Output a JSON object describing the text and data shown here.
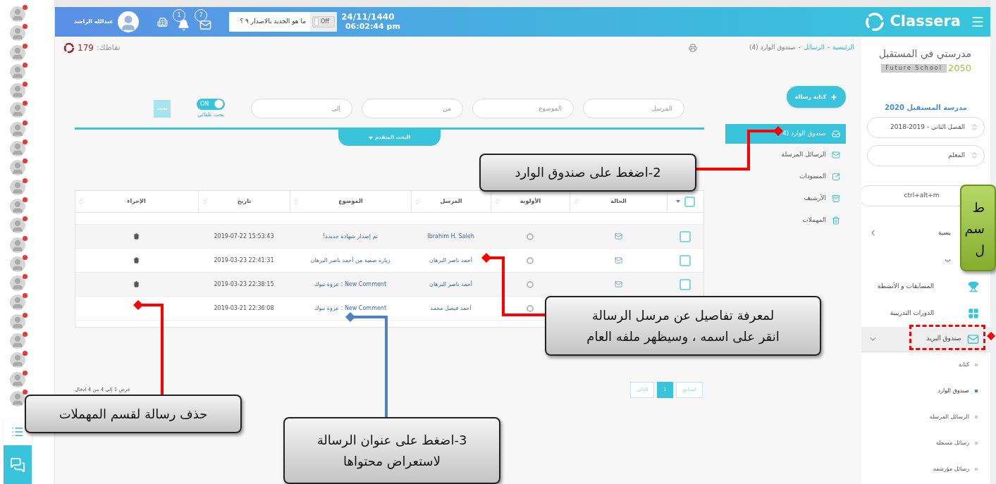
{
  "header": {
    "user_name": "عبدالله الراشد",
    "notifications": "1",
    "messages": "7",
    "whats_new": "ما هو الجديد بالاصدار ٩ ؟",
    "whats_new_toggle": {
      "label": "Off",
      "on": false
    },
    "date": "24/11/1440",
    "time": "06:02:44 pm",
    "brand": "Classera"
  },
  "contacts": [
    {
      "online": true
    },
    {
      "online": true
    },
    {
      "online": true
    },
    {
      "online": true
    },
    {
      "online": true
    },
    {
      "online": true
    },
    {
      "online": true
    },
    {
      "online": true
    },
    {
      "online": true
    },
    {
      "online": true
    },
    {
      "online": true
    },
    {
      "online": true
    },
    {
      "online": true
    },
    {
      "online": true
    },
    {
      "online": true
    },
    {
      "online": true
    },
    {
      "online": true
    },
    {
      "online": true
    },
    {
      "online": true
    },
    {
      "online": true
    },
    {
      "online": true
    }
  ],
  "points": {
    "label": "نقاطك:",
    "value": "179"
  },
  "breadcrumb": {
    "separator": "-",
    "items": [
      {
        "text": "الرئيسية",
        "link": true
      },
      {
        "text": "الرسائل",
        "link": true
      },
      {
        "text": "صندوق الوارد (4)",
        "link": false
      }
    ]
  },
  "search": {
    "fields": [
      {
        "placeholder": "المرسل"
      },
      {
        "placeholder": "الموضوع"
      },
      {
        "placeholder": "من"
      },
      {
        "placeholder": "إلى"
      }
    ],
    "instant": {
      "label": "ON",
      "caption": "بحث تلقائي",
      "on": true
    },
    "button": "بحث",
    "advanced": "البحث المتقدم"
  },
  "compose_button": "كتابة رسالة",
  "folders": [
    {
      "label": "صندوق الوارد (4",
      "selected": true
    },
    {
      "label": "الرسائل المرسلة",
      "selected": false
    },
    {
      "label": "المسودات",
      "selected": false
    },
    {
      "label": "الأرشيف",
      "selected": false
    },
    {
      "label": "المهملات",
      "selected": false
    }
  ],
  "table": {
    "columns": [
      "الحالة",
      "الأولوية",
      "المرسل",
      "الموضوع",
      "تاريخ",
      "الإجراء"
    ],
    "header_checked": false,
    "rows": [
      {
        "checked": false,
        "priority": false,
        "sender": "Ibrahim H. Saleh",
        "subject": "تم إصدار شهادة جديدة!",
        "date": "2019-07-22 15:53:43",
        "deletable": true
      },
      {
        "checked": false,
        "priority": false,
        "sender": "أحمد ناصر البرهان",
        "subject": "زيارة صفية من أحمد ناصر البرهان",
        "date": "2019-03-23 22:41:31",
        "deletable": true
      },
      {
        "checked": false,
        "priority": false,
        "sender": "أحمد ناصر البرهان",
        "subject": "New Comment : عزوة تبوك",
        "date": "2019-03-23 22:38:15",
        "deletable": true
      },
      {
        "priority": false,
        "sender": "أحمد فيصل محمد",
        "subject": "New Comment : عزوة تبوك",
        "date": "2019-03-21 22:36:08",
        "deletable": false
      }
    ]
  },
  "footer": {
    "info": "عرض 1 إلى 4 من 4 ادخال",
    "pages": [
      {
        "label": "السابق",
        "selected": false
      },
      {
        "label": "1",
        "selected": true
      },
      {
        "label": "التالي",
        "selected": false
      }
    ]
  },
  "sidebar": {
    "school_logo": {
      "title": "مدرستي في المستقبل",
      "subtitle": "Future School",
      "year": "2050"
    },
    "school_name": "مدرسة المستقبل 2020",
    "term": "الفصل الثاني - 2019-2018",
    "role": "المعلم",
    "search_value": "ctrl+alt+m",
    "nav": [
      {
        "label": "يسية",
        "kind": "chevron"
      },
      {
        "label": "ب",
        "kind": "plain"
      },
      {
        "label": "المسابقات و الأنشطة",
        "kind": "icon"
      },
      {
        "label": "الدورات التدريبية",
        "kind": "icon"
      },
      {
        "label": "صندوق البريد",
        "kind": "group",
        "expanded": true,
        "children": [
          {
            "label": "كتابة",
            "selected": false
          },
          {
            "label": "صندوق الوارد",
            "selected": true
          },
          {
            "label": "الرسائل المرسلة",
            "selected": false
          },
          {
            "label": "رسائل مسجلة",
            "selected": false
          },
          {
            "label": "رسائل مؤرشفة",
            "selected": false
          }
        ]
      }
    ]
  },
  "callouts": [
    {
      "kind": "note",
      "color": "#ff0000",
      "lines": [
        "2-اضغط على صندوق الوارد"
      ]
    },
    {
      "kind": "note",
      "color": "#ff0000",
      "lines": [
        "لمعرفة تفاصيل عن مرسل الرسالة",
        "انقر على اسمه ، وسيظهر ملفه العام"
      ]
    },
    {
      "kind": "note",
      "color": "#ff0000",
      "lines": [
        "حذف رسالة لقسم المهملات"
      ]
    },
    {
      "kind": "note",
      "color": "#4f81bd",
      "lines": [
        "3-اضغط على عنوان الرسالة",
        "لاستعراض محتواها"
      ]
    },
    {
      "kind": "tip",
      "lines": [
        "ط",
        "سم",
        "ل"
      ]
    }
  ]
}
